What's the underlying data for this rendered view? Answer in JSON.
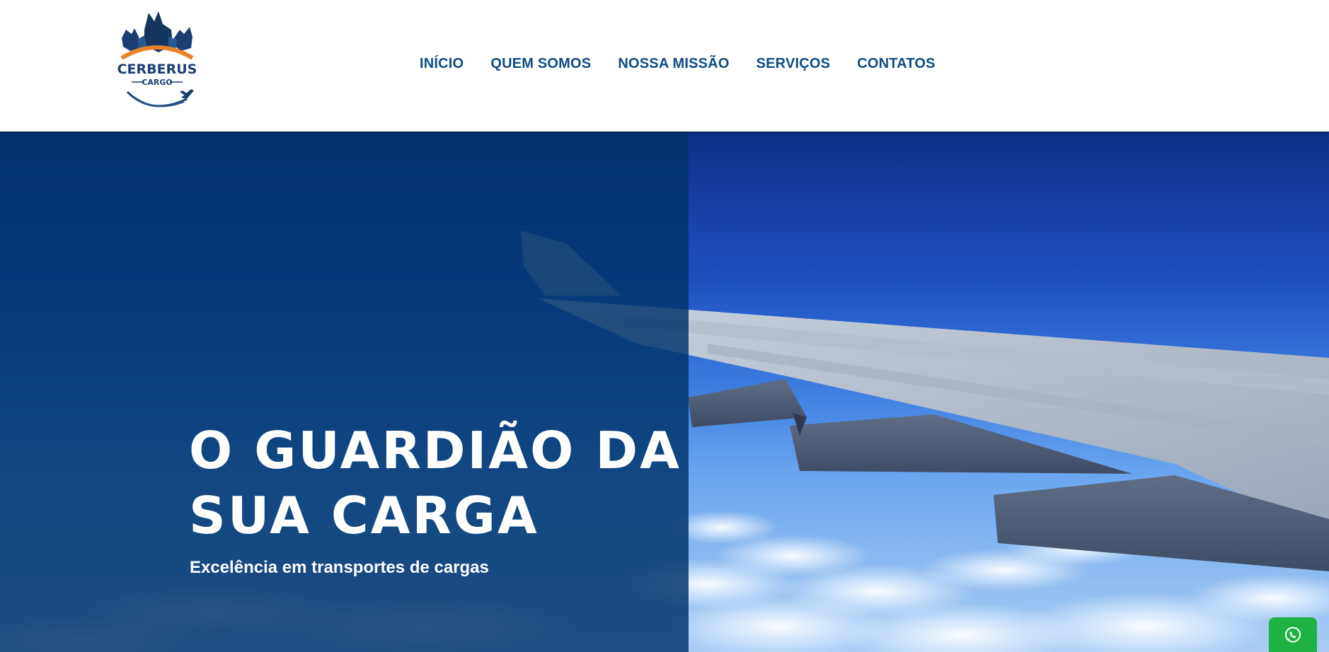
{
  "header": {
    "logo": {
      "brand": "CERBERUS",
      "sub": "CARGO"
    },
    "nav": [
      {
        "label": "INÍCIO"
      },
      {
        "label": "QUEM SOMOS"
      },
      {
        "label": "NOSSA MISSÃO"
      },
      {
        "label": "SERVIÇOS"
      },
      {
        "label": "CONTATOS"
      }
    ]
  },
  "hero": {
    "title_line1": "O GUARDIÃO DA",
    "title_line2": "SUA CARGA",
    "subtitle": "Excelência em transportes de cargas",
    "image": "airplane-wing-above-clouds"
  },
  "floating": {
    "whatsapp_icon": "whatsapp-icon"
  },
  "colors": {
    "nav_text": "#0f4b86",
    "overlay": "#00346c",
    "whatsapp": "#1fb141",
    "logo_orange": "#e8832a"
  }
}
